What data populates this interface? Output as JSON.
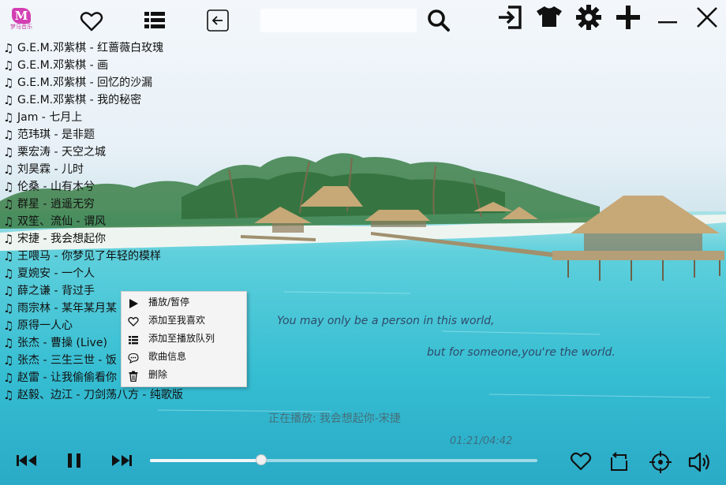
{
  "app": {
    "logo_text": "M",
    "logo_caption": "梦马音乐"
  },
  "toolbar": {
    "icons": [
      "heart-icon",
      "list-icon",
      "back-icon",
      "search-icon",
      "exit-icon",
      "shirt-icon",
      "gear-icon",
      "plus-icon",
      "minimize-icon",
      "close-icon"
    ],
    "search_value": ""
  },
  "songs": [
    {
      "label": "G.E.M.邓紫棋 - 红蔷薇白玫瑰"
    },
    {
      "label": "G.E.M.邓紫棋 - 画"
    },
    {
      "label": "G.E.M.邓紫棋 - 回忆的沙漏"
    },
    {
      "label": "G.E.M.邓紫棋 - 我的秘密"
    },
    {
      "label": "Jam - 七月上"
    },
    {
      "label": "范玮琪 - 是非题"
    },
    {
      "label": "栗宏涛 - 天空之城"
    },
    {
      "label": "刘昊霖 - 儿时"
    },
    {
      "label": "伦桑 - 山有木兮"
    },
    {
      "label": "群星 - 逍遥无穷"
    },
    {
      "label": "双笙、流仙 - 谓风"
    },
    {
      "label": "宋捷 - 我会想起你"
    },
    {
      "label": "王喂马 - 你梦见了年轻的模样"
    },
    {
      "label": "夏婉安 - 一个人"
    },
    {
      "label": "薛之谦 - 背过手"
    },
    {
      "label": "雨宗林 - 某年某月某"
    },
    {
      "label": "原得一人心"
    },
    {
      "label": "张杰 - 曹操 (Live)"
    },
    {
      "label": "张杰 - 三生三世 - 饭"
    },
    {
      "label": "赵雷 - 让我偷偷看你"
    },
    {
      "label": "赵毅、边江 - 刀剑荡八方 - 纯歌版"
    }
  ],
  "context_menu": {
    "items": [
      {
        "label": "播放/暂停",
        "icon": "play-icon"
      },
      {
        "label": "添加至我喜欢",
        "icon": "heart-icon"
      },
      {
        "label": "添加至播放队列",
        "icon": "list-icon"
      },
      {
        "label": "歌曲信息",
        "icon": "info-icon"
      },
      {
        "label": "删除",
        "icon": "trash-icon"
      }
    ]
  },
  "quote": {
    "line1": "You may only be a person in this world,",
    "line2": "but for someone,you're the world."
  },
  "now_playing": {
    "prefix": "正在播放:",
    "title": "我会想起你-宋捷"
  },
  "player": {
    "time": "01:21/04:42",
    "progress": 0.2872,
    "controls": [
      "prev-icon",
      "pause-icon",
      "next-icon",
      "heart-icon",
      "loop-icon",
      "locate-icon",
      "volume-icon"
    ]
  },
  "colors": {
    "logo": "#d23fb3",
    "sea": "#2fb3cc",
    "text_dark": "#111111"
  }
}
